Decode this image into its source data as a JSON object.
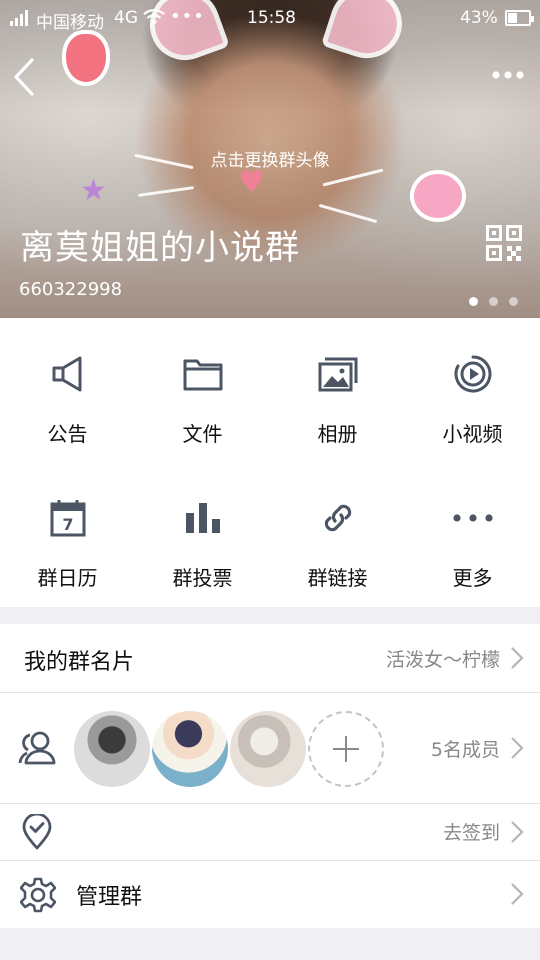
{
  "status_bar": {
    "carrier": "中国移动",
    "network": "4G",
    "dots": "•••",
    "time": "15:58",
    "battery": "43%"
  },
  "header": {
    "avatar_hint": "点击更换群头像",
    "group_name": "离莫姐姐的小说群",
    "group_id": "660322998",
    "more_icon": "more-icon",
    "qr_icon": "qr-code-icon",
    "carousel_page": 1,
    "carousel_total": 3
  },
  "features": [
    {
      "label": "公告",
      "icon": "megaphone-icon"
    },
    {
      "label": "文件",
      "icon": "folder-icon"
    },
    {
      "label": "相册",
      "icon": "album-icon"
    },
    {
      "label": "小视频",
      "icon": "video-icon"
    },
    {
      "label": "群日历",
      "icon": "calendar-icon"
    },
    {
      "label": "群投票",
      "icon": "vote-icon"
    },
    {
      "label": "群链接",
      "icon": "link-icon"
    },
    {
      "label": "更多",
      "icon": "more-dots-icon"
    }
  ],
  "calendar_day": "7",
  "card_row": {
    "title": "我的群名片",
    "value": "活泼女～柠檬"
  },
  "members": {
    "count_label": "5名成员",
    "avatars": [
      "member-avatar-1",
      "member-avatar-2",
      "member-avatar-3"
    ]
  },
  "checkin": {
    "label": "去签到"
  },
  "manage": {
    "title": "管理群"
  },
  "colors": {
    "icon_gray": "#4c5563",
    "divider": "#e3e3e6",
    "background": "#efeff4",
    "value_text": "#888888"
  }
}
